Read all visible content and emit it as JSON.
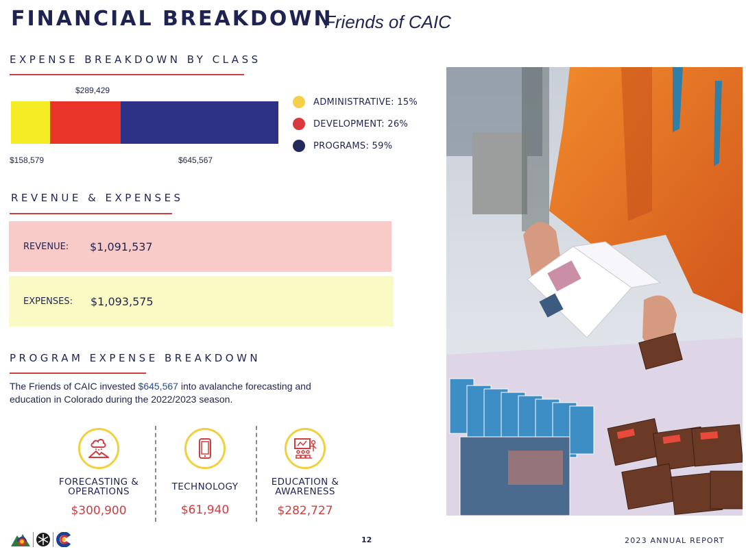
{
  "header": {
    "title": "FINANCIAL BREAKDOWN",
    "subtitle": "Friends of CAIC"
  },
  "expense_by_class": {
    "heading": "EXPENSE BREAKDOWN BY CLASS",
    "labels": {
      "administrative": "$158,579",
      "development": "$289,429",
      "programs": "$645,567"
    },
    "legend": [
      {
        "text": "ADMINISTRATIVE: 15%",
        "color": "#f5ce4a"
      },
      {
        "text": "DEVELOPMENT: 26%",
        "color": "#d7393c"
      },
      {
        "text": "PROGRAMS: 59%",
        "color": "#24295c"
      }
    ]
  },
  "chart_data": {
    "type": "bar",
    "categories": [
      "Administrative",
      "Development",
      "Programs"
    ],
    "values": [
      158579,
      289429,
      645567
    ],
    "percent": [
      15,
      26,
      59
    ],
    "colors": [
      "#f5ec25",
      "#e9342a",
      "#2e3287"
    ],
    "title": "EXPENSE BREAKDOWN BY CLASS",
    "stacked": true,
    "orientation": "horizontal"
  },
  "revenue_expenses": {
    "heading": "REVENUE & EXPENSES",
    "revenue_label": "REVENUE:",
    "revenue_value": "$1,091,537",
    "expenses_label": "EXPENSES:",
    "expenses_value": "$1,093,575",
    "revenue_color": "#f8cbc8",
    "expenses_color": "#fafac5"
  },
  "program_expense": {
    "heading": "PROGRAM EXPENSE BREAKDOWN",
    "para_before": "The Friends of CAIC invested ",
    "para_highlight": "$645,567",
    "para_after": " into avalanche forecasting and education in Colorado during the 2022/2023 season.",
    "items": [
      {
        "line1": "FORECASTING &",
        "line2": "OPERATIONS",
        "amount": "$300,900",
        "icon": "mountain-snow-icon"
      },
      {
        "line1": "TECHNOLOGY",
        "line2": "",
        "amount": "$61,940",
        "icon": "tablet-icon"
      },
      {
        "line1": "EDUCATION  &",
        "line2": "AWARENESS",
        "amount": "$282,727",
        "icon": "classroom-icon"
      }
    ]
  },
  "footer": {
    "page_number": "12",
    "report_label": "2023 ANNUAL REPORT"
  }
}
